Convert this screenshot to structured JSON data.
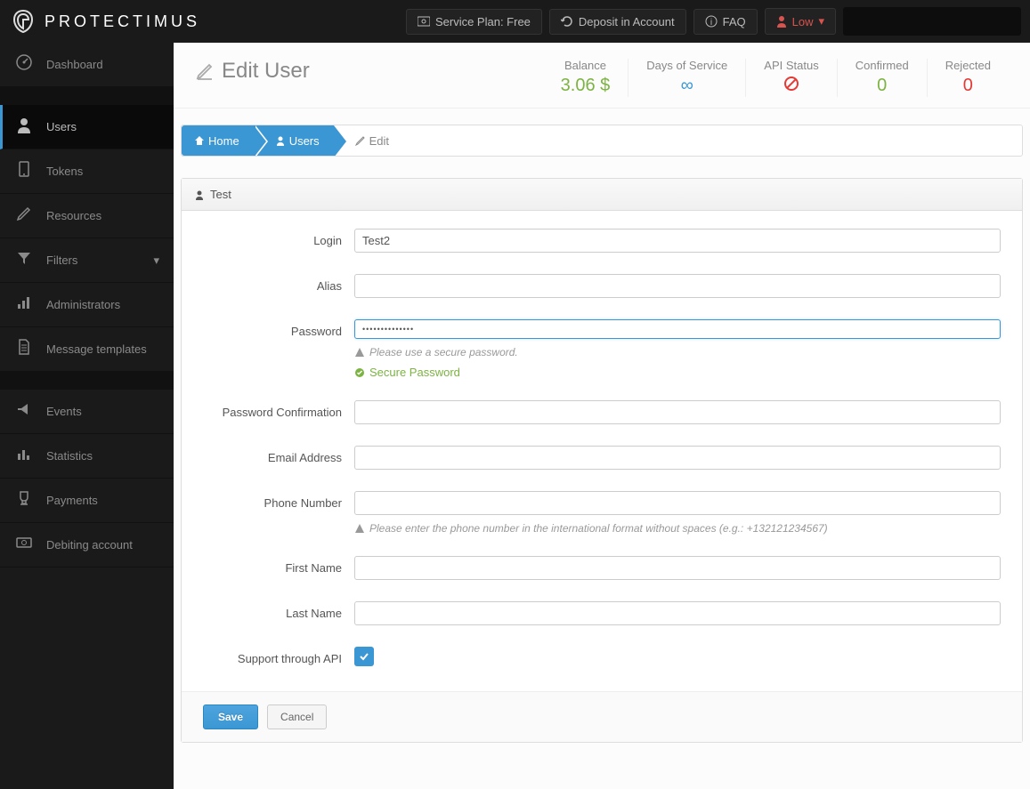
{
  "header": {
    "brand": "PROTECTIMUS",
    "service_plan": "Service Plan: Free",
    "deposit": "Deposit in Account",
    "faq": "FAQ",
    "security_level": "Low"
  },
  "sidebar": {
    "items": [
      {
        "label": "Dashboard",
        "icon": "dashboard"
      },
      {
        "label": "Users",
        "icon": "user",
        "active": true
      },
      {
        "label": "Tokens",
        "icon": "tablet"
      },
      {
        "label": "Resources",
        "icon": "edit"
      },
      {
        "label": "Filters",
        "icon": "filter",
        "caret": true
      },
      {
        "label": "Administrators",
        "icon": "signal"
      },
      {
        "label": "Message templates",
        "icon": "file"
      }
    ],
    "items2": [
      {
        "label": "Events",
        "icon": "bullhorn"
      },
      {
        "label": "Statistics",
        "icon": "bar"
      },
      {
        "label": "Payments",
        "icon": "trophy"
      },
      {
        "label": "Debiting account",
        "icon": "money"
      }
    ]
  },
  "page": {
    "title": "Edit User"
  },
  "stats": {
    "balance_label": "Balance",
    "balance_value": "3.06 $",
    "days_label": "Days of Service",
    "days_value": "∞",
    "api_label": "API Status",
    "confirmed_label": "Confirmed",
    "confirmed_value": "0",
    "rejected_label": "Rejected",
    "rejected_value": "0"
  },
  "breadcrumb": {
    "home": "Home",
    "users": "Users",
    "edit": "Edit"
  },
  "panel": {
    "title": "Test"
  },
  "form": {
    "login_label": "Login",
    "login_value": "Test2",
    "alias_label": "Alias",
    "alias_value": "",
    "password_label": "Password",
    "password_value": "••••••••••••••",
    "password_hint": "Please use a secure password.",
    "password_ok": "Secure Password",
    "confirm_label": "Password Confirmation",
    "confirm_value": "",
    "email_label": "Email Address",
    "email_value": "",
    "phone_label": "Phone Number",
    "phone_value": "",
    "phone_hint": "Please enter the phone number in the international format without spaces (e.g.: +132121234567)",
    "first_label": "First Name",
    "first_value": "",
    "last_label": "Last Name",
    "last_value": "",
    "api_label": "Support through API",
    "api_checked": true
  },
  "actions": {
    "save": "Save",
    "cancel": "Cancel"
  }
}
